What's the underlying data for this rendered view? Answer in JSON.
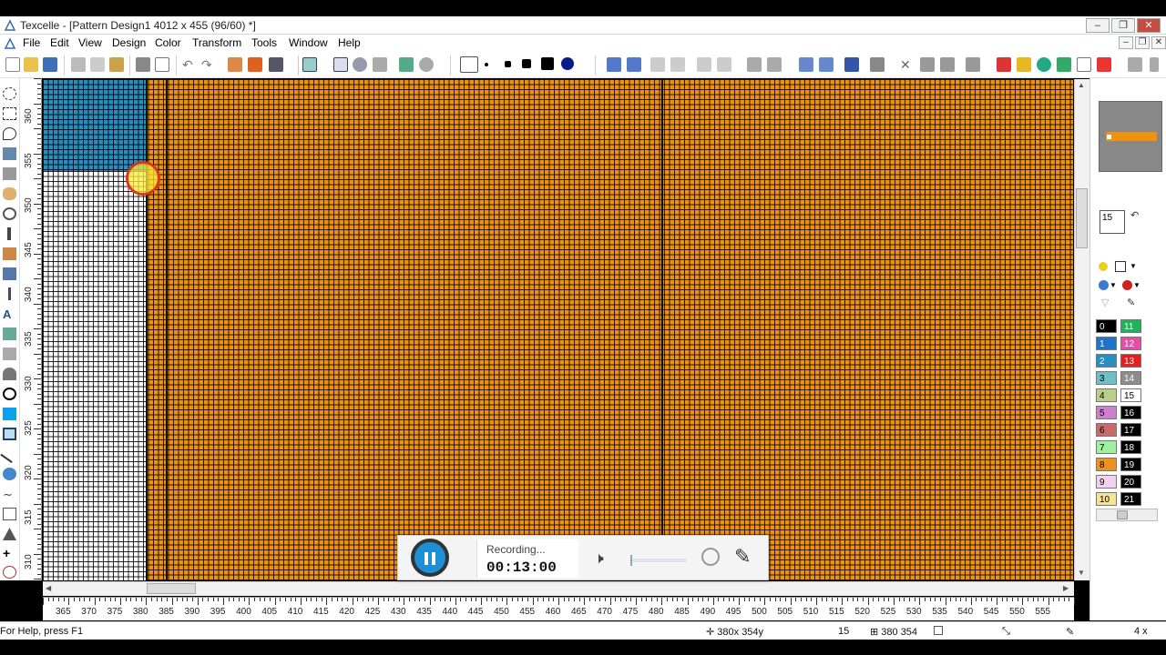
{
  "window": {
    "title": "Texcelle - [Pattern Design1 4012 x 455 (96/60) *]"
  },
  "menu": [
    "File",
    "Edit",
    "View",
    "Design",
    "Color",
    "Transform",
    "Tools",
    "Window",
    "Help"
  ],
  "rulers": {
    "horizontal": [
      "365",
      "370",
      "375",
      "380",
      "385",
      "390",
      "395",
      "400",
      "405",
      "410",
      "415",
      "420",
      "425",
      "430",
      "435",
      "440",
      "445",
      "450",
      "455",
      "460",
      "465",
      "470",
      "475",
      "480",
      "485",
      "490",
      "495",
      "500",
      "505",
      "510",
      "515",
      "520",
      "525",
      "530",
      "535",
      "540",
      "545",
      "550",
      "555"
    ],
    "vertical": [
      "360",
      "355",
      "350",
      "345",
      "340",
      "335",
      "330",
      "325",
      "320",
      "315",
      "310"
    ]
  },
  "colors": {
    "orange": "#ef9211",
    "blue": "#2a8fc0",
    "white": "#ffffff"
  },
  "palette": {
    "current_number": "15",
    "left": [
      {
        "n": "0",
        "c": "#000000",
        "t": "#fff"
      },
      {
        "n": "1",
        "c": "#1f74c8",
        "t": "#fff"
      },
      {
        "n": "2",
        "c": "#2a8fc0",
        "t": "#fff"
      },
      {
        "n": "3",
        "c": "#6dc0c8",
        "t": "#000"
      },
      {
        "n": "4",
        "c": "#b9cf8a",
        "t": "#000"
      },
      {
        "n": "5",
        "c": "#cd7fd0",
        "t": "#000"
      },
      {
        "n": "6",
        "c": "#c96a6a",
        "t": "#000"
      },
      {
        "n": "7",
        "c": "#9ef0a0",
        "t": "#000"
      },
      {
        "n": "8",
        "c": "#f09020",
        "t": "#000"
      },
      {
        "n": "9",
        "c": "#f3d2f0",
        "t": "#000"
      },
      {
        "n": "10",
        "c": "#f6e39a",
        "t": "#000"
      }
    ],
    "right": [
      {
        "n": "11",
        "c": "#1fb25a",
        "t": "#fff"
      },
      {
        "n": "12",
        "c": "#e24fa8",
        "t": "#fff"
      },
      {
        "n": "13",
        "c": "#e22020",
        "t": "#fff"
      },
      {
        "n": "14",
        "c": "#8c8c8c",
        "t": "#fff"
      },
      {
        "n": "15",
        "c": "#ffffff",
        "t": "#000"
      },
      {
        "n": "16",
        "c": "#000000",
        "t": "#fff"
      },
      {
        "n": "17",
        "c": "#000000",
        "t": "#fff"
      },
      {
        "n": "18",
        "c": "#000000",
        "t": "#fff"
      },
      {
        "n": "19",
        "c": "#000000",
        "t": "#fff"
      },
      {
        "n": "20",
        "c": "#000000",
        "t": "#fff"
      },
      {
        "n": "21",
        "c": "#000000",
        "t": "#fff"
      }
    ]
  },
  "status": {
    "help": "For Help, press F1",
    "cursor": "380x 354y",
    "color_index": "15",
    "position": "380 354",
    "zoom": "4 x"
  },
  "recorder": {
    "label": "Recording...",
    "time": "00:13:00"
  }
}
